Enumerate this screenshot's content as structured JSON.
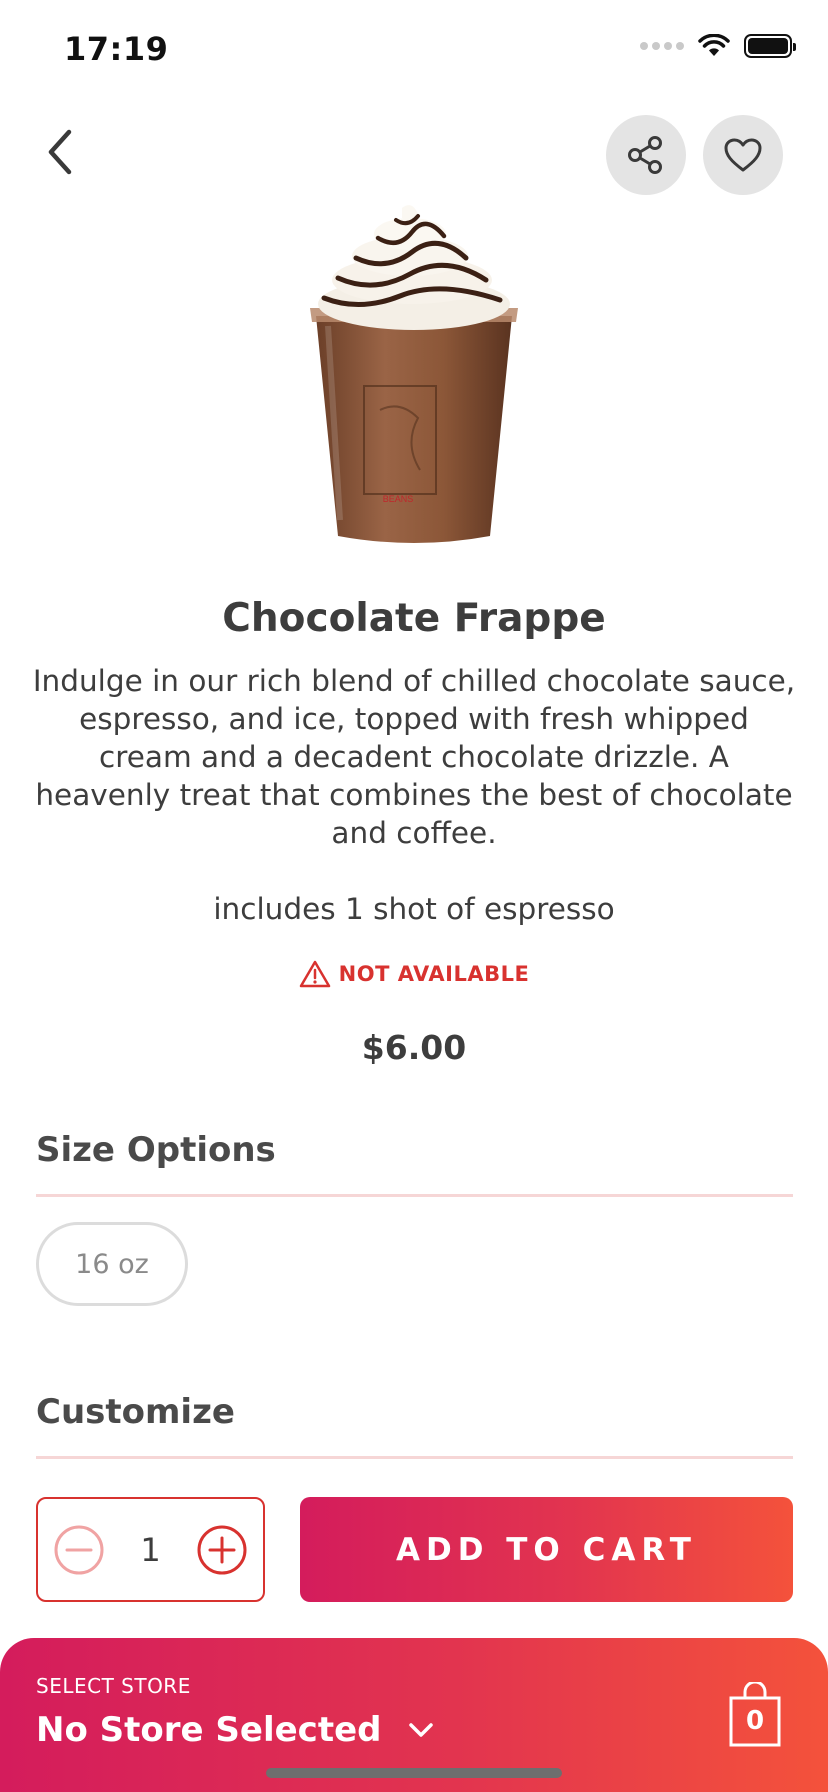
{
  "status_bar": {
    "time": "17:19",
    "icons": [
      "cellular-signal-icon",
      "wifi-icon",
      "battery-icon"
    ]
  },
  "header": {
    "back_icon": "chevron-left-icon",
    "share_icon": "share-icon",
    "favorite_icon": "heart-icon"
  },
  "product": {
    "image_icon": "chocolate-frappe-image",
    "title": "Chocolate Frappe",
    "description": "Indulge in our rich blend of chilled chocolate sauce, espresso, and ice, topped with fresh whipped cream and a decadent chocolate drizzle. A heavenly treat that combines the best of chocolate and coffee.",
    "espresso_note": "includes 1 shot of espresso",
    "availability": "NOT AVAILABLE",
    "availability_icon": "warning-triangle-icon",
    "price": "$6.00"
  },
  "size_options": {
    "title": "Size Options",
    "options": [
      "16 oz"
    ]
  },
  "customize": {
    "title": "Customize"
  },
  "quantity": {
    "value": "1",
    "decrement_icon": "minus-circle-icon",
    "increment_icon": "plus-circle-icon"
  },
  "add_to_cart": {
    "label": "ADD TO CART"
  },
  "store_bar": {
    "label": "SELECT STORE",
    "value": "No Store Selected",
    "dropdown_icon": "chevron-down-icon",
    "cart_icon": "shopping-bag-icon",
    "cart_count": "0"
  },
  "colors": {
    "accent": "#d8322f",
    "gradient_start": "#d41c5c",
    "gradient_end": "#f4523b",
    "text": "#3d3d3d",
    "divider": "#f6d6d6",
    "button_bg": "#e4e4e4"
  }
}
